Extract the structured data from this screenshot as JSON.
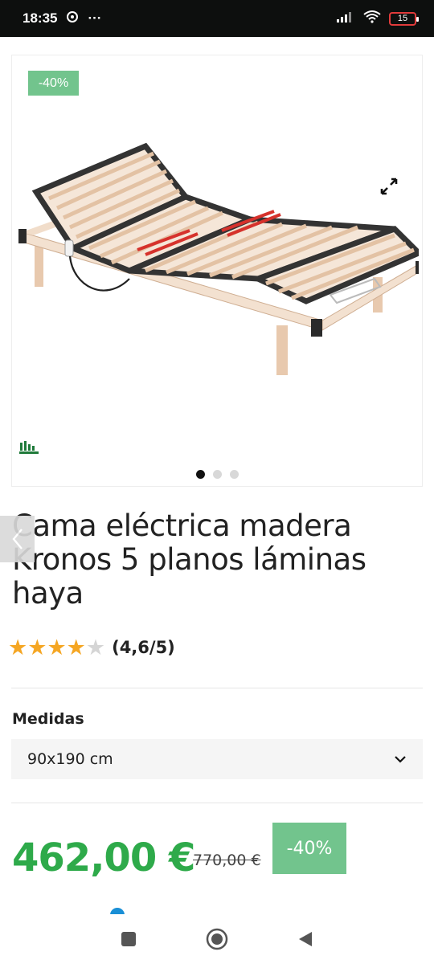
{
  "status_bar": {
    "time": "18:35",
    "more": "···",
    "battery": "15"
  },
  "product": {
    "discount_tag": "-40%",
    "title": "Cama eléctrica madera Kronos 5 planos láminas haya",
    "rating": {
      "stars": 4,
      "max": 5,
      "text": "(4,6/5)"
    },
    "size_label": "Medidas",
    "size_selected": "90x190 cm",
    "price": "462,00 €",
    "old_price": "770,00 €",
    "discount": "-40%",
    "gallery": {
      "slides": 3,
      "active": 0
    }
  },
  "colors": {
    "accent_green": "#2eaa4a",
    "tag_green": "#72c48d",
    "star": "#f5a623"
  },
  "icons": {
    "expand": "expand-icon",
    "chevron": "chevron-down-icon",
    "back": "chevron-left-icon"
  }
}
